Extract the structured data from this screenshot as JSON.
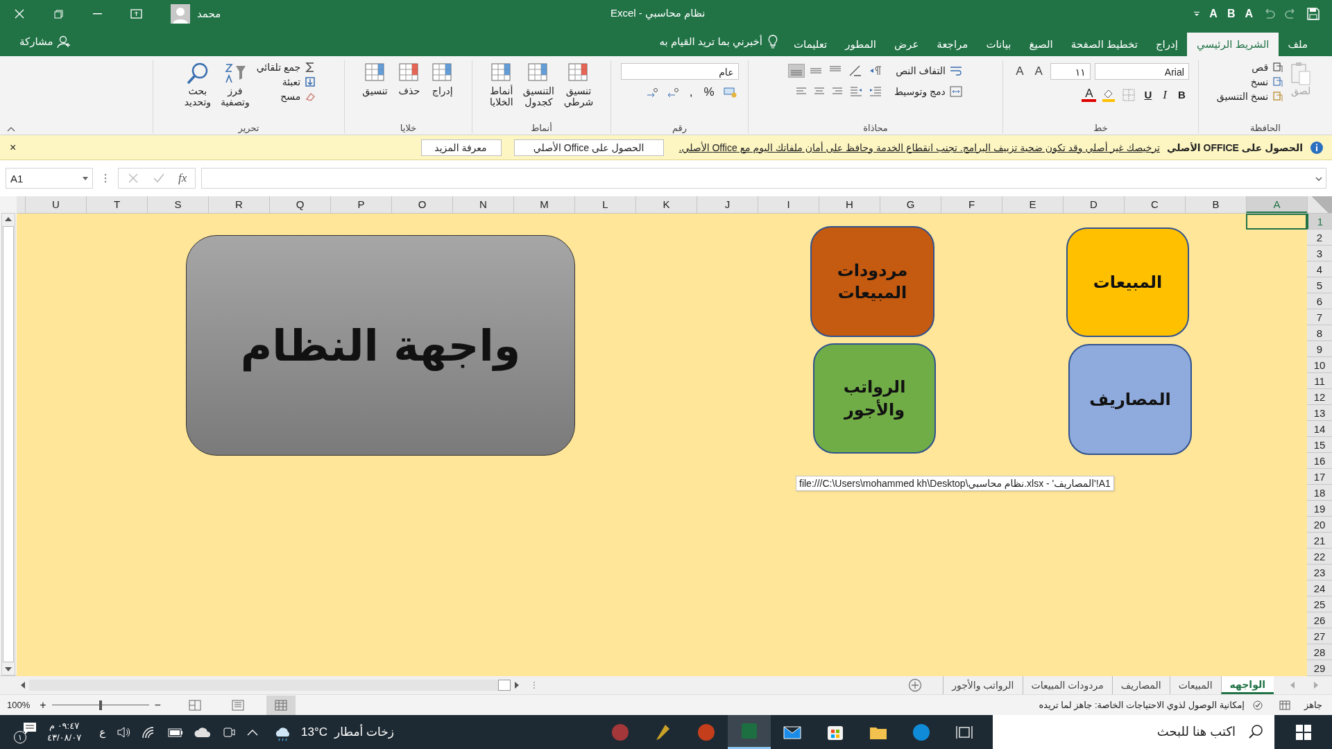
{
  "window": {
    "title": "نظام محاسبي - Excel",
    "user": "محمد",
    "quick_access": [
      "A",
      "B",
      "A"
    ]
  },
  "tabs": [
    {
      "label": "ملف",
      "selected": false
    },
    {
      "label": "الشريط الرئيسي",
      "selected": true
    },
    {
      "label": "إدراج",
      "selected": false
    },
    {
      "label": "تخطيط الصفحة",
      "selected": false
    },
    {
      "label": "الصيغ",
      "selected": false
    },
    {
      "label": "بيانات",
      "selected": false
    },
    {
      "label": "مراجعة",
      "selected": false
    },
    {
      "label": "عرض",
      "selected": false
    },
    {
      "label": "المطور",
      "selected": false
    },
    {
      "label": "تعليمات",
      "selected": false
    }
  ],
  "tell_me": "أخبرني بما تريد القيام به",
  "share": "مشاركة",
  "ribbon": {
    "groups": [
      {
        "kind": "clipboard",
        "name": "الحافظة",
        "large": [
          {
            "label": "لصق",
            "disabled": true
          }
        ],
        "small": [
          {
            "label": "قص"
          },
          {
            "label": "نسخ"
          },
          {
            "label": "نسخ التنسيق"
          }
        ]
      },
      {
        "kind": "font",
        "name": "خط",
        "font": "Arial",
        "size": "١١",
        "size_buttons": [
          "A",
          "A"
        ],
        "styles": [
          "B",
          "I",
          "U"
        ],
        "color_letter": "A"
      },
      {
        "kind": "alignment",
        "name": "محاذاة",
        "small": [
          {
            "label": "التفاف النص"
          },
          {
            "label": "دمج وتوسيط"
          }
        ],
        "vertical_align": [
          {
            "selected": false
          },
          {
            "selected": false
          },
          {
            "selected": true
          }
        ]
      },
      {
        "kind": "number",
        "name": "رقم",
        "format": "عام",
        "symbols": [
          "%",
          ","
        ]
      },
      {
        "kind": "large",
        "name": "أنماط",
        "large": [
          {
            "label": "تنسيق شرطي"
          },
          {
            "label": "التنسيق كجدول"
          },
          {
            "label": "أنماط الخلايا"
          }
        ]
      },
      {
        "kind": "large",
        "name": "خلايا",
        "large": [
          {
            "label": "إدراج"
          },
          {
            "label": "حذف"
          },
          {
            "label": "تنسيق"
          }
        ]
      },
      {
        "kind": "editing",
        "name": "تحرير",
        "small": [
          {
            "label": "جمع تلقائي"
          },
          {
            "label": "تعبئة"
          },
          {
            "label": "مسح"
          }
        ],
        "large": [
          {
            "label": "فرز وتصفية"
          },
          {
            "label": "بحث وتحديد"
          }
        ]
      }
    ]
  },
  "message_bar": {
    "title": "الحصول على OFFICE الأصلي",
    "message": "ترخيصك غير أصلي وقد تكون ضحية تزييف البرامج. تجنب انقطاع الخدمة وحافظ على أمان ملفاتك اليوم مع Office الأصلي.",
    "buttons": [
      "الحصول على Office الأصلي",
      "معرفة المزيد"
    ],
    "close": "×"
  },
  "formula_bar": {
    "name_box": "A1",
    "fx": "fx"
  },
  "columns": [
    {
      "label": "A",
      "selected": true
    },
    {
      "label": "B",
      "selected": false
    },
    {
      "label": "C",
      "selected": false
    },
    {
      "label": "D",
      "selected": false
    },
    {
      "label": "E",
      "selected": false
    },
    {
      "label": "F",
      "selected": false
    },
    {
      "label": "G",
      "selected": false
    },
    {
      "label": "H",
      "selected": false
    },
    {
      "label": "I",
      "selected": false
    },
    {
      "label": "J",
      "selected": false
    },
    {
      "label": "K",
      "selected": false
    },
    {
      "label": "L",
      "selected": false
    },
    {
      "label": "M",
      "selected": false
    },
    {
      "label": "N",
      "selected": false
    },
    {
      "label": "O",
      "selected": false
    },
    {
      "label": "P",
      "selected": false
    },
    {
      "label": "Q",
      "selected": false
    },
    {
      "label": "R",
      "selected": false
    },
    {
      "label": "S",
      "selected": false
    },
    {
      "label": "T",
      "selected": false
    },
    {
      "label": "U",
      "selected": false
    }
  ],
  "rows": [
    {
      "label": "1",
      "selected": true
    },
    {
      "label": "2",
      "selected": false
    },
    {
      "label": "3",
      "selected": false
    },
    {
      "label": "4",
      "selected": false
    },
    {
      "label": "5",
      "selected": false
    },
    {
      "label": "6",
      "selected": false
    },
    {
      "label": "7",
      "selected": false
    },
    {
      "label": "8",
      "selected": false
    },
    {
      "label": "9",
      "selected": false
    },
    {
      "label": "10",
      "selected": false
    },
    {
      "label": "11",
      "selected": false
    },
    {
      "label": "12",
      "selected": false
    },
    {
      "label": "13",
      "selected": false
    },
    {
      "label": "14",
      "selected": false
    },
    {
      "label": "15",
      "selected": false
    },
    {
      "label": "16",
      "selected": false
    },
    {
      "label": "17",
      "selected": false
    },
    {
      "label": "18",
      "selected": false
    },
    {
      "label": "19",
      "selected": false
    },
    {
      "label": "20",
      "selected": false
    },
    {
      "label": "21",
      "selected": false
    },
    {
      "label": "22",
      "selected": false
    },
    {
      "label": "23",
      "selected": false
    },
    {
      "label": "24",
      "selected": false
    },
    {
      "label": "25",
      "selected": false
    },
    {
      "label": "26",
      "selected": false
    },
    {
      "label": "27",
      "selected": false
    },
    {
      "label": "28",
      "selected": false
    },
    {
      "label": "29",
      "selected": false
    }
  ],
  "shapes": [
    {
      "kind": "button",
      "label": "المبيعات",
      "color": "#ffc000"
    },
    {
      "kind": "button",
      "label": "مردودات المبيعات",
      "color": "#c55a11"
    },
    {
      "kind": "title",
      "label": "واجهة النظام",
      "color": "#8c8c8c"
    },
    {
      "kind": "button",
      "label": "المصاريف",
      "color": "#8faadc"
    },
    {
      "kind": "button",
      "label": "الرواتب والأجور",
      "color": "#70ad47"
    }
  ],
  "tooltip": "file:///C:\\Users\\mohammed kh\\Desktop\\نظام محاسبي.xlsx - 'المصاريف'!A1",
  "sheet_tabs": [
    {
      "label": "الواجهه",
      "selected": true
    },
    {
      "label": "المبيعات",
      "selected": false
    },
    {
      "label": "المصاريف",
      "selected": false
    },
    {
      "label": "مردودات المبيعات",
      "selected": false
    },
    {
      "label": "الرواتب والأجور",
      "selected": false
    }
  ],
  "status_bar": {
    "ready": "جاهز",
    "accessibility": "إمكانية الوصول لذوي الاحتياجات الخاصة: جاهز لما تريده",
    "views": [
      {
        "selected": true
      },
      {
        "selected": false
      },
      {
        "selected": false
      }
    ],
    "zoom": {
      "level": 0.5,
      "reading": "100%",
      "plus": "+",
      "minus": "−"
    }
  },
  "taskbar": {
    "search": {
      "placeholder": "اكتب هنا للبحث"
    },
    "apps": [
      {
        "selected": false
      },
      {
        "selected": false
      },
      {
        "selected": false
      },
      {
        "selected": true
      },
      {
        "selected": false
      },
      {
        "selected": false
      },
      {
        "selected": false
      },
      {
        "selected": false
      }
    ],
    "weather": {
      "temp": "13°C",
      "text": "زخات أمطار"
    },
    "language": "ع",
    "time": "٠٩:٤٧ م",
    "date": "٤٣/٠٨/٠٧",
    "notifications": "١"
  }
}
